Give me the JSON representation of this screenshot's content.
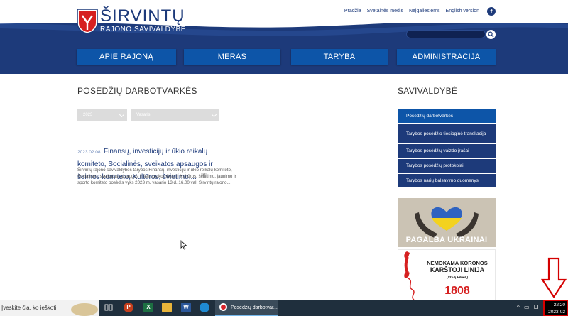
{
  "header": {
    "logo_title": "ŠIRVINTŲ",
    "logo_subtitle": "RAJONO SAVIVALDYBĖ",
    "top_links": [
      "Pradžia",
      "Svetainės medis",
      "Neįgaliesiems",
      "English version"
    ],
    "facebook_glyph": "f",
    "search_placeholder": ""
  },
  "nav": {
    "items": [
      "APIE RAJONĄ",
      "MERAS",
      "TARYBA",
      "ADMINISTRACIJA"
    ]
  },
  "main": {
    "title": "POSĖDŽIŲ DARBOTVARKĖS",
    "filters": {
      "year": "2023",
      "month": "Vasaris"
    },
    "article": {
      "date": "2023.02.08",
      "title": "Finansų, investicijų ir ūkio reikalų komiteto, Socialinės, sveikatos apsaugos ir šeimos komiteto, Kultūros, švietimo,...",
      "badge": "0",
      "excerpt": "Širvintų rajono savivaldybės tarybos Finansų, investicijų ir ūkio reikalų komiteto, Socialinės, sveikatos apsaugos ir šeimos komiteto ir Kultūros, švietimo, jaunimo ir sporto komiteto posėdis vyks 2023 m. vasario 13 d. 16.00 val. Širvintų rajono..."
    }
  },
  "sidebar": {
    "title": "SAVIVALDYBĖ",
    "menu": [
      "Posėdžių darbotvarkės",
      "Tarybos posėdžio tiesioginė transliacija",
      "Tarybos posėdžių vaizdo įrašai",
      "Tarybos posėdžių protokolai",
      "Tarybos narių balsavimo duomenys"
    ],
    "banner_ukraine": "PAGALBA UKRAINAI",
    "banner_covid": {
      "line1": "NEMOKAMA KORONOS",
      "line2": "KARŠTOJI LINIJA",
      "line3": "(VISĄ PARĄ)",
      "number": "1808"
    }
  },
  "taskbar": {
    "search_text": "Įveskite čia, ko ieškoti",
    "active_app_label": "Posėdžių darbotvar...",
    "clock_time": "22:20",
    "clock_date": "2023-02",
    "tray_language": "LI"
  },
  "colors": {
    "brand_blue": "#1d3a7a",
    "nav_blue": "#0d55a8",
    "alert_red": "#d40000"
  }
}
